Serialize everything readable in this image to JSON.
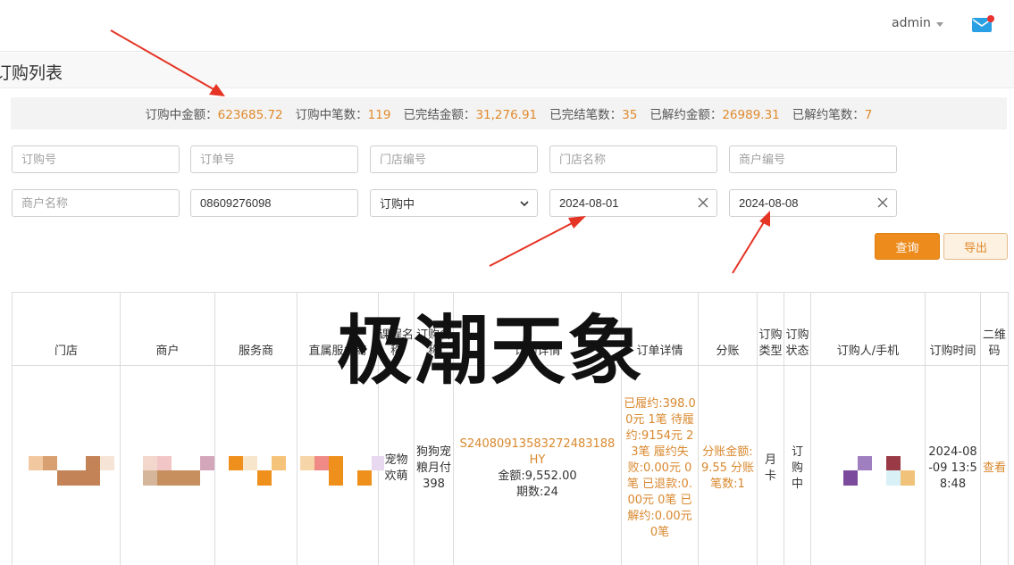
{
  "header": {
    "user_name": "admin",
    "mail_icon": "mail-notification-icon"
  },
  "page": {
    "title": "订购列表"
  },
  "summary": {
    "items": [
      {
        "label": "订购中金额：",
        "value": "623685.72"
      },
      {
        "label": "订购中笔数：",
        "value": "119"
      },
      {
        "label": "已完结金额：",
        "value": "31,276.91"
      },
      {
        "label": "已完结笔数：",
        "value": "35"
      },
      {
        "label": "已解约金额：",
        "value": "26989.31"
      },
      {
        "label": "已解约笔数：",
        "value": "7"
      }
    ]
  },
  "filters": {
    "order_no_placeholder": "订购号",
    "sub_order_no_placeholder": "订单号",
    "store_no_placeholder": "门店编号",
    "store_name_placeholder": "门店名称",
    "merchant_no_placeholder": "商户编号",
    "merchant_name_placeholder": "商户名称",
    "phone_value": "08609276098",
    "status_selected": "订购中",
    "date_start": "2024-08-01",
    "date_end": "2024-08-08"
  },
  "actions": {
    "query_label": "查询",
    "export_label": "导出"
  },
  "table": {
    "headers": [
      "门店",
      "商户",
      "服务商",
      "直属服务商",
      "课程名称",
      "订购名称",
      "订购详情",
      "订单详情",
      "分账",
      "订购类型",
      "订购状态",
      "订购人/手机",
      "订购时间",
      "二维码"
    ],
    "rows": [
      {
        "course": "宠物欢萌",
        "plan": "狗狗宠粮月付398",
        "order_id": "S2408091358327248318 8HY",
        "order_id_text": "S24080913583272483188HY",
        "amount": "金额:9,552.00",
        "periods": "期数:24",
        "order_detail": "已履约:398.00元 1笔 待履约:9154元 23笔 履约失败:0.00元 0笔 已退款:0.00元 0笔 已解约:0.00元 0笔",
        "split": "分账金额:9.55 分账笔数:1",
        "type": "月卡",
        "status": "订购中",
        "time": "2024-08-09 13:58:48",
        "qrcode_link": "查看"
      }
    ]
  },
  "watermark": {
    "text": "极潮天象"
  },
  "colors": {
    "accent": "#ED8B1D",
    "summary_value": "#E08A2C",
    "annotation_arrow": "#E53324"
  }
}
